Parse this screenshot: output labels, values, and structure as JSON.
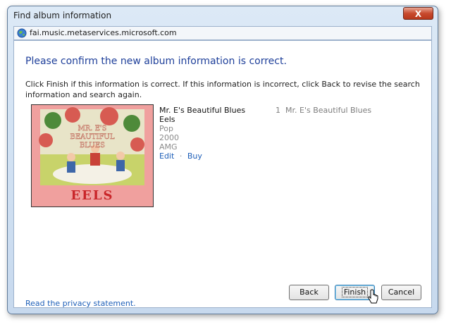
{
  "window": {
    "title": "Find album information",
    "close_label": "X"
  },
  "address_bar": {
    "url": "fai.music.metaservices.microsoft.com"
  },
  "content": {
    "heading": "Please confirm the new album information is correct.",
    "instructions": "Click Finish if this information is correct. If this information is incorrect, click Back to revise the search information and search again."
  },
  "album": {
    "title": "Mr. E's Beautiful Blues",
    "artist": "Eels",
    "genre": "Pop",
    "year": "2000",
    "source": "AMG",
    "edit_link": "Edit",
    "separator": "·",
    "buy_link": "Buy",
    "cover_text": "EELS",
    "cover_title_text": "MR. E'S BEAUTIFUL BLUES"
  },
  "tracks": [
    {
      "number": "1",
      "name": "Mr. E's Beautiful Blues"
    }
  ],
  "footer": {
    "privacy_link": "Read the privacy statement.",
    "back_label": "Back",
    "finish_label": "Finish",
    "cancel_label": "Cancel"
  },
  "colors": {
    "accent": "#1e3f9a",
    "link": "#1e5fb8"
  }
}
